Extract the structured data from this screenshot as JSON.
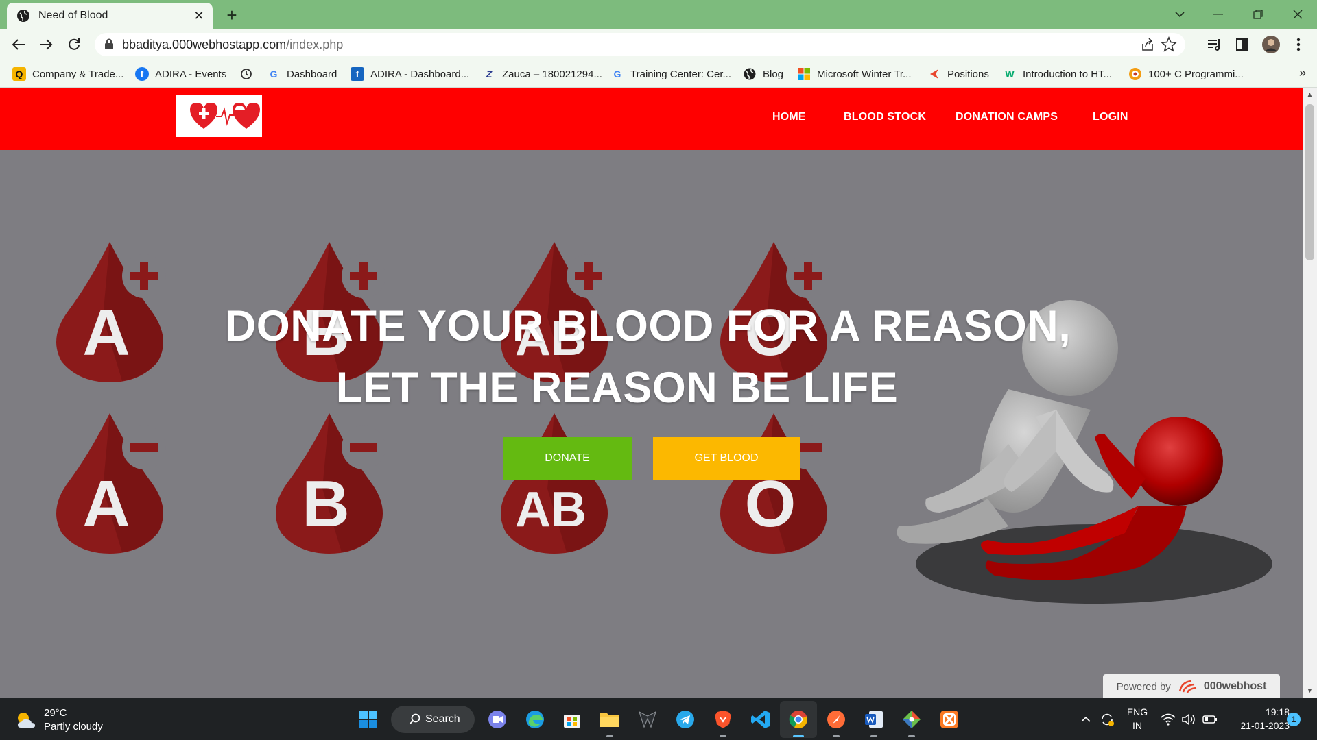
{
  "browser": {
    "tab_title": "Need of Blood",
    "url_domain": "bbaditya.000webhostapp.com",
    "url_path": "/index.php",
    "bookmarks": [
      {
        "label": "Company & Trade...",
        "icon": "Q"
      },
      {
        "label": "ADIRA - Events",
        "icon": "f"
      },
      {
        "label": "",
        "icon": "history-icon"
      },
      {
        "label": "Dashboard",
        "icon": "G"
      },
      {
        "label": "ADIRA - Dashboard...",
        "icon": "f"
      },
      {
        "label": "Zauca – 180021294...",
        "icon": "Z"
      },
      {
        "label": "Training Center: Cer...",
        "icon": "G"
      },
      {
        "label": "Blog",
        "icon": "globe-icon"
      },
      {
        "label": "Microsoft Winter Tr...",
        "icon": "ms"
      },
      {
        "label": "Positions",
        "icon": "arrow"
      },
      {
        "label": "Introduction to HT...",
        "icon": "W"
      },
      {
        "label": "100+ C Programmi...",
        "icon": "c"
      }
    ],
    "bookmarks_more": "»"
  },
  "site": {
    "nav": [
      "HOME",
      "BLOOD STOCK",
      "DONATION CAMPS",
      "LOGIN"
    ],
    "hero_line1": "DONATE YOUR BLOOD FOR A REASON,",
    "hero_line2": "LET THE REASON BE LIFE",
    "donate_label": "DONATE",
    "get_blood_label": "GET BLOOD",
    "blood_groups": [
      "A",
      "B",
      "AB",
      "O",
      "A",
      "B",
      "AB",
      "O"
    ],
    "powered_by": "Powered by",
    "powered_brand": "000webhost",
    "colors": {
      "navbar": "#ff0000",
      "donate": "#64ba11",
      "get_blood": "#fcb800",
      "drop": "#8b1a1a"
    }
  },
  "taskbar": {
    "temperature": "29°C",
    "weather": "Partly cloudy",
    "search_label": "Search",
    "language": "ENG",
    "region": "IN",
    "time": "19:18",
    "date": "21-01-2023",
    "notification_count": "1"
  }
}
